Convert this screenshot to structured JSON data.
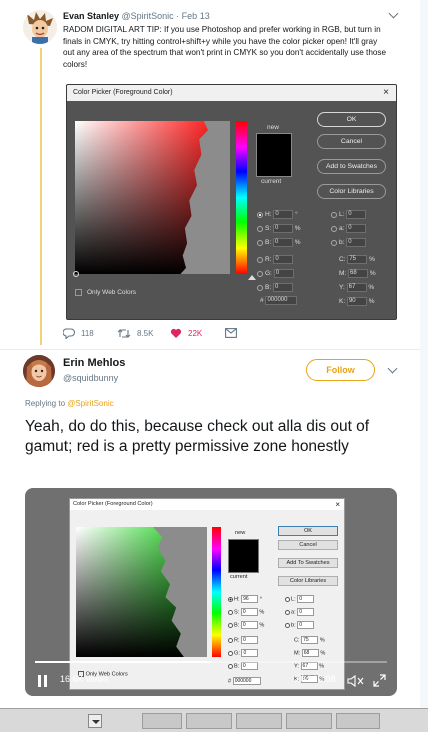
{
  "tweet1": {
    "name": "Evan Stanley",
    "meta": " @SpiritSonic · Feb 13",
    "text": "RADOM DIGITAL ART TIP: If you use Photoshop and prefer working in RGB, but turn in finals in CMYK, try hitting control+shift+y while you have the color picker open! It'll gray out any area of the spectrum that won't print in CMYK so you don't accidentally use those colors!",
    "reply_count": "118",
    "retweet_count": "8.5K",
    "like_count": "22K",
    "colors": {
      "thread_line": "#f3d27a",
      "like": "#e0245e"
    }
  },
  "ps_dialog": {
    "title": "Color Picker (Foreground Color)",
    "close": "×",
    "label_new": "new",
    "label_current": "current",
    "buttons": {
      "ok": "OK",
      "cancel": "Cancel",
      "add": "Add to Swatches",
      "libraries": "Color Libraries"
    },
    "only_web": "Only Web Colors",
    "fields": {
      "h": {
        "label": "H:",
        "value": "0",
        "unit": "°"
      },
      "s": {
        "label": "S:",
        "value": "0",
        "unit": "%"
      },
      "b": {
        "label": "B:",
        "value": "0",
        "unit": "%"
      },
      "r": {
        "label": "R:",
        "value": "0"
      },
      "g": {
        "label": "G:",
        "value": "0"
      },
      "bb": {
        "label": "B:",
        "value": "0"
      },
      "l": {
        "label": "L:",
        "value": "0"
      },
      "a": {
        "label": "a:",
        "value": "0"
      },
      "b2": {
        "label": "b:",
        "value": "0"
      },
      "c": {
        "label": "C:",
        "value": "75",
        "unit": "%"
      },
      "m": {
        "label": "M:",
        "value": "68",
        "unit": "%"
      },
      "y": {
        "label": "Y:",
        "value": "67",
        "unit": "%"
      },
      "k": {
        "label": "K:",
        "value": "90",
        "unit": "%"
      },
      "hex": {
        "label": "#",
        "value": "000000"
      }
    }
  },
  "tweet2": {
    "name": "Erin Mehlos",
    "handle": "@squidbunny",
    "follow_label": "Follow",
    "replying_prefix": "Replying to ",
    "replying_to": "@SpiritSonic",
    "text": "Yeah, do do this, because check out alla dis out of gamut; red is a pretty permissive zone honestly",
    "accent": "#e8a317"
  },
  "video": {
    "views": "16.6K views",
    "time": "0:04 / 0:08",
    "progress": 0.5,
    "dialog": {
      "title": "Color Picker (Foreground Color)",
      "close": "×",
      "label_new": "new",
      "label_current": "current",
      "buttons": {
        "ok": "OK",
        "cancel": "Cancel",
        "add": "Add To Swatches",
        "libraries": "Color Libraries"
      },
      "only_web": "Only Web Colors",
      "fields": {
        "h": {
          "label": "H:",
          "value": "96",
          "unit": "°"
        },
        "s": {
          "label": "S:",
          "value": "0",
          "unit": "%"
        },
        "b": {
          "label": "B:",
          "value": "0",
          "unit": "%"
        },
        "r": {
          "label": "R:",
          "value": "0"
        },
        "g": {
          "label": "G:",
          "value": "0"
        },
        "bb": {
          "label": "B:",
          "value": "0"
        },
        "l": {
          "label": "L:",
          "value": "0"
        },
        "a": {
          "label": "a:",
          "value": "0"
        },
        "b2": {
          "label": "b:",
          "value": "0"
        },
        "c": {
          "label": "C:",
          "value": "75",
          "unit": "%"
        },
        "m": {
          "label": "M:",
          "value": "68",
          "unit": "%"
        },
        "y": {
          "label": "Y:",
          "value": "67",
          "unit": "%"
        },
        "k": {
          "label": "K:",
          "value": "90",
          "unit": "%"
        },
        "hex": {
          "label": "#",
          "value": "000000"
        }
      }
    }
  },
  "icons": [
    "reply-icon",
    "retweet-icon",
    "heart-icon",
    "mail-icon",
    "caret-down-icon",
    "pause-icon",
    "mute-icon",
    "fullscreen-icon"
  ]
}
